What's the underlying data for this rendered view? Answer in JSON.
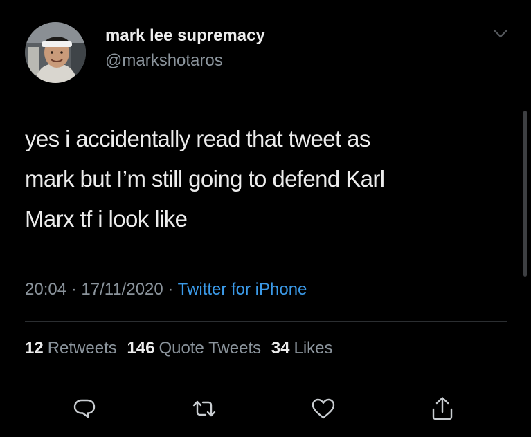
{
  "author": {
    "display_name": "mark lee supremacy",
    "handle": "@markshotaros"
  },
  "tweet": {
    "text": "yes i accidentally read that tweet as\nmark but I’m still going to defend Karl\nMarx tf i look like",
    "time": "20:04",
    "date": "17/11/2020",
    "separator": "·",
    "source": "Twitter for iPhone"
  },
  "stats": {
    "retweets_count": "12",
    "retweets_label": "Retweets",
    "quotes_count": "146",
    "quotes_label": "Quote Tweets",
    "likes_count": "34",
    "likes_label": "Likes"
  },
  "icons": {
    "more": "chevron-down-icon",
    "reply": "reply-icon",
    "retweet": "retweet-icon",
    "like": "heart-icon",
    "share": "share-icon"
  },
  "colors": {
    "background": "#000000",
    "text": "#ececec",
    "muted": "#8b949c",
    "link": "#3b9ae8",
    "divider": "#2b2e31"
  }
}
